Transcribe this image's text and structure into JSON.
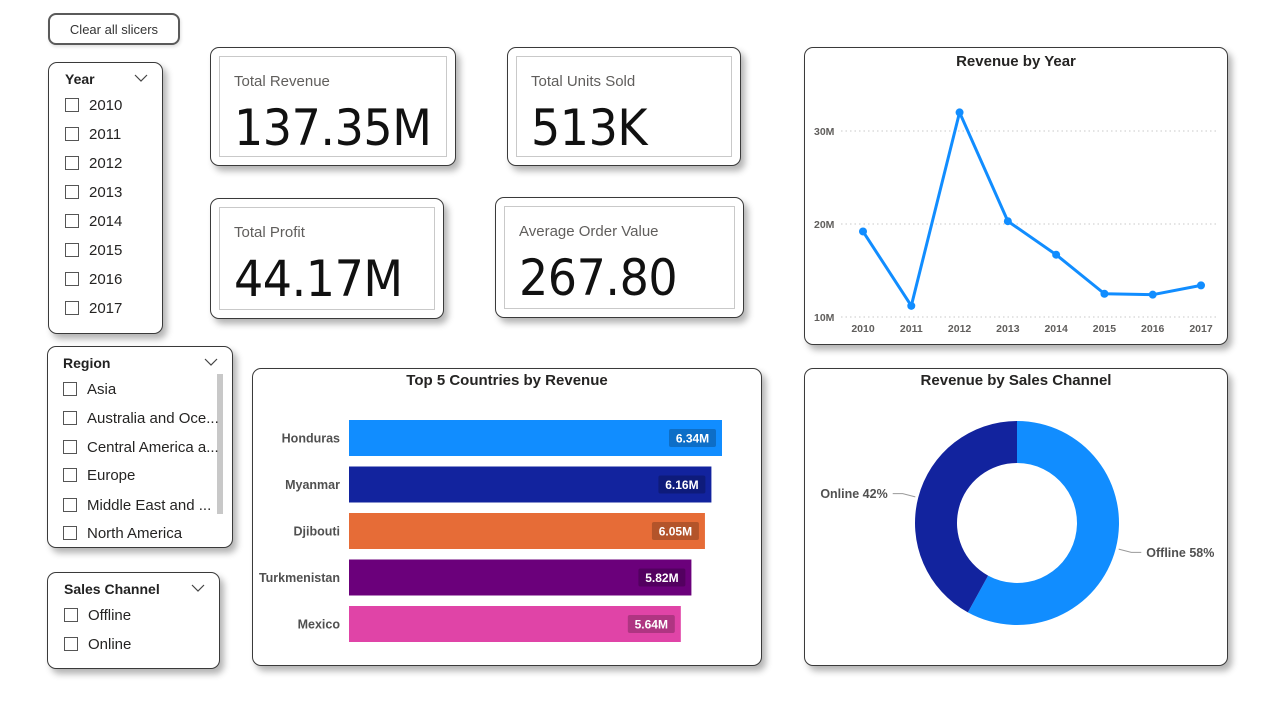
{
  "clear_button": {
    "label": "Clear all slicers"
  },
  "slicers": {
    "year": {
      "title": "Year",
      "options": [
        "2010",
        "2011",
        "2012",
        "2013",
        "2014",
        "2015",
        "2016",
        "2017"
      ]
    },
    "region": {
      "title": "Region",
      "options": [
        "Asia",
        "Australia and Oce...",
        "Central America a...",
        "Europe",
        "Middle East and ...",
        "North America"
      ]
    },
    "sales_channel": {
      "title": "Sales Channel",
      "options": [
        "Offline",
        "Online"
      ]
    }
  },
  "kpis": {
    "total_revenue": {
      "label": "Total Revenue",
      "value": "137.35M"
    },
    "total_units": {
      "label": "Total Units Sold",
      "value": "513K"
    },
    "total_profit": {
      "label": "Total Profit",
      "value": "44.17M"
    },
    "avg_order": {
      "label": "Average Order Value",
      "value": "267.80"
    }
  },
  "colors": {
    "blue": "#118DFF",
    "navy": "#12239E",
    "orange": "#E66C37",
    "purple": "#6B007B",
    "pink": "#E044A7"
  },
  "chart_data": [
    {
      "type": "line",
      "title": "Revenue by Year",
      "x": [
        "2010",
        "2011",
        "2012",
        "2013",
        "2014",
        "2015",
        "2016",
        "2017"
      ],
      "y_tick_labels": [
        "10M",
        "20M",
        "30M"
      ],
      "ylim": [
        10,
        30
      ],
      "y_unit": "M",
      "series": [
        {
          "values": [
            19.2,
            11.2,
            32.0,
            20.3,
            16.7,
            12.5,
            12.4,
            13.4
          ]
        }
      ],
      "color": "#118DFF",
      "grid": true
    },
    {
      "type": "bar",
      "orientation": "horizontal",
      "title": "Top 5 Countries by Revenue",
      "categories": [
        "Honduras",
        "Myanmar",
        "Djibouti",
        "Turkmenistan",
        "Mexico"
      ],
      "values": [
        6.34,
        6.16,
        6.05,
        5.82,
        5.64
      ],
      "labels": [
        "6.34M",
        "6.16M",
        "6.05M",
        "5.82M",
        "5.64M"
      ],
      "colors": [
        "#118DFF",
        "#12239E",
        "#E66C37",
        "#6B007B",
        "#E044A7"
      ]
    },
    {
      "type": "pie",
      "donut": true,
      "title": "Revenue by Sales Channel",
      "slices": [
        {
          "label": "Offline 58%",
          "value": 58,
          "color": "#118DFF"
        },
        {
          "label": "Online 42%",
          "value": 42,
          "color": "#12239E"
        }
      ]
    }
  ]
}
